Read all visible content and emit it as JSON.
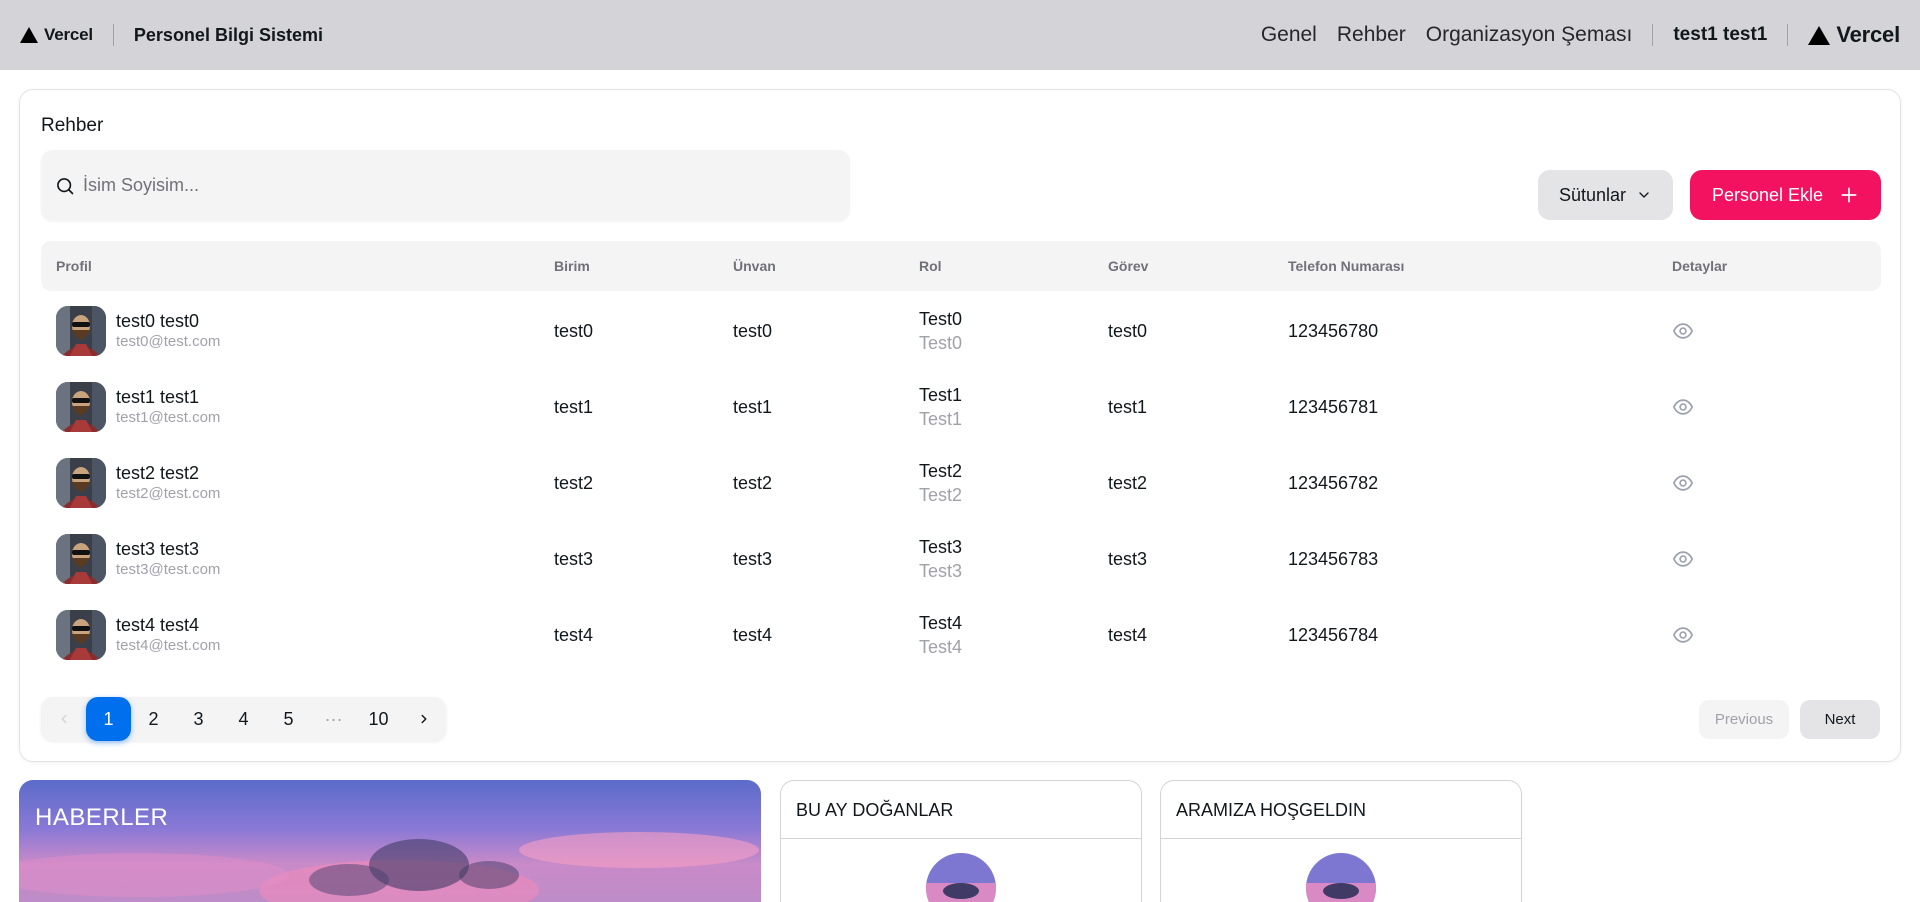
{
  "topbar": {
    "brand": "Vercel",
    "app_title": "Personel Bilgi Sistemi",
    "nav": [
      "Genel",
      "Rehber",
      "Organizasyon Şeması"
    ],
    "user": "test1 test1",
    "brand_right": "Vercel"
  },
  "directory": {
    "title": "Rehber",
    "search_placeholder": "İsim Soyisim...",
    "columns_button": "Sütunlar",
    "add_button": "Personel Ekle",
    "headers": [
      "Profil",
      "Birim",
      "Ünvan",
      "Rol",
      "Görev",
      "Telefon Numarası",
      "Detaylar"
    ],
    "rows": [
      {
        "name": "test0 test0",
        "email": "test0@test.com",
        "birim": "test0",
        "unvan": "test0",
        "rol": "Test0",
        "rol_sub": "Test0",
        "gorev": "test0",
        "phone": "123456780"
      },
      {
        "name": "test1 test1",
        "email": "test1@test.com",
        "birim": "test1",
        "unvan": "test1",
        "rol": "Test1",
        "rol_sub": "Test1",
        "gorev": "test1",
        "phone": "123456781"
      },
      {
        "name": "test2 test2",
        "email": "test2@test.com",
        "birim": "test2",
        "unvan": "test2",
        "rol": "Test2",
        "rol_sub": "Test2",
        "gorev": "test2",
        "phone": "123456782"
      },
      {
        "name": "test3 test3",
        "email": "test3@test.com",
        "birim": "test3",
        "unvan": "test3",
        "rol": "Test3",
        "rol_sub": "Test3",
        "gorev": "test3",
        "phone": "123456783"
      },
      {
        "name": "test4 test4",
        "email": "test4@test.com",
        "birim": "test4",
        "unvan": "test4",
        "rol": "Test4",
        "rol_sub": "Test4",
        "gorev": "test4",
        "phone": "123456784"
      }
    ],
    "pagination": {
      "pages": [
        "1",
        "2",
        "3",
        "4",
        "5",
        "···",
        "10"
      ],
      "current": "1",
      "previous": "Previous",
      "next": "Next"
    }
  },
  "widgets": {
    "news_title": "HABERLER",
    "birthdays_title": "BU AY DOĞANLAR",
    "welcome_title": "ARAMIZA HOŞGELDIN"
  },
  "colors": {
    "primary": "#006fee",
    "accent": "#f31260",
    "topbar": "#d4d4d8"
  }
}
